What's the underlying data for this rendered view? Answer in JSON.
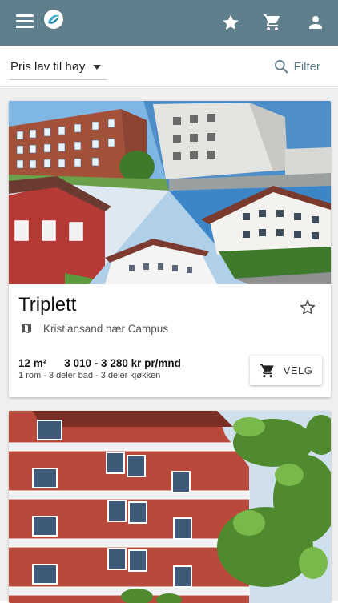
{
  "colors": {
    "appbar": "#5f7f8c",
    "accent": "#5f7f8c"
  },
  "sort": {
    "label": "Pris lav til høy"
  },
  "filter": {
    "label": "Filter"
  },
  "listings": [
    {
      "title": "Triplett",
      "location": "Kristiansand nær Campus",
      "size": "12 m²",
      "price": "3 010 - 3 280 kr pr/mnd",
      "details": "1 rom - 3 deler bad - 3 deler kjøkken",
      "select_label": "VELG"
    }
  ],
  "icons": [
    "menu-icon",
    "logo-icon",
    "star-icon",
    "cart-icon",
    "account-icon",
    "search-icon",
    "map-icon",
    "star-outline-icon"
  ]
}
